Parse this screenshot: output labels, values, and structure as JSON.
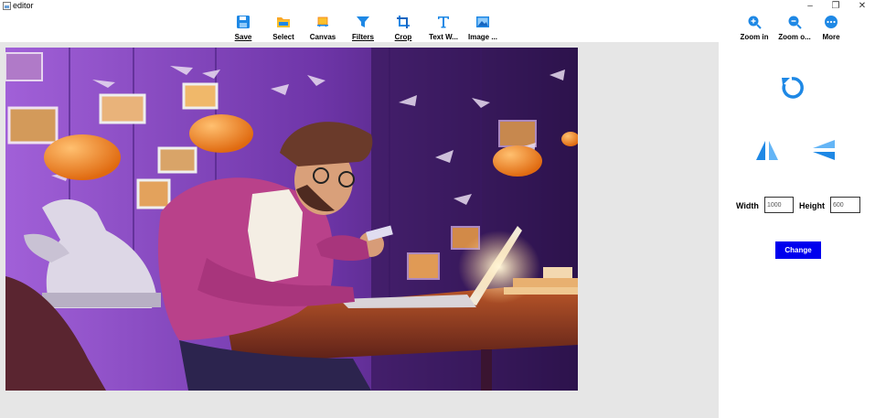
{
  "window": {
    "title": "editor",
    "minimize_glyph": "–",
    "maximize_glyph": "❐",
    "close_glyph": "✕"
  },
  "toolbar": {
    "items": [
      {
        "label": "Save",
        "icon": "save-icon"
      },
      {
        "label": "Select",
        "icon": "folder-icon"
      },
      {
        "label": "Canvas",
        "icon": "canvas-icon"
      },
      {
        "label": "Filters",
        "icon": "filter-icon"
      },
      {
        "label": "Crop",
        "icon": "crop-icon"
      },
      {
        "label": "Text W...",
        "icon": "text-icon"
      },
      {
        "label": "Image ...",
        "icon": "image-icon"
      }
    ],
    "zoom_in": "Zoom in",
    "zoom_out": "Zoom o...",
    "more": "More"
  },
  "panel": {
    "rotate_icon": "rotate-icon",
    "flip_horizontal_icon": "flip-horizontal-icon",
    "flip_vertical_icon": "flip-vertical-icon",
    "width_label": "Width",
    "width_value": "1000",
    "height_label": "Height",
    "height_value": "600",
    "change_label": "Change"
  },
  "colors": {
    "accent": "#1e88e5",
    "change_button": "#0000ee",
    "canvas_bg": "#e6e6e6"
  }
}
